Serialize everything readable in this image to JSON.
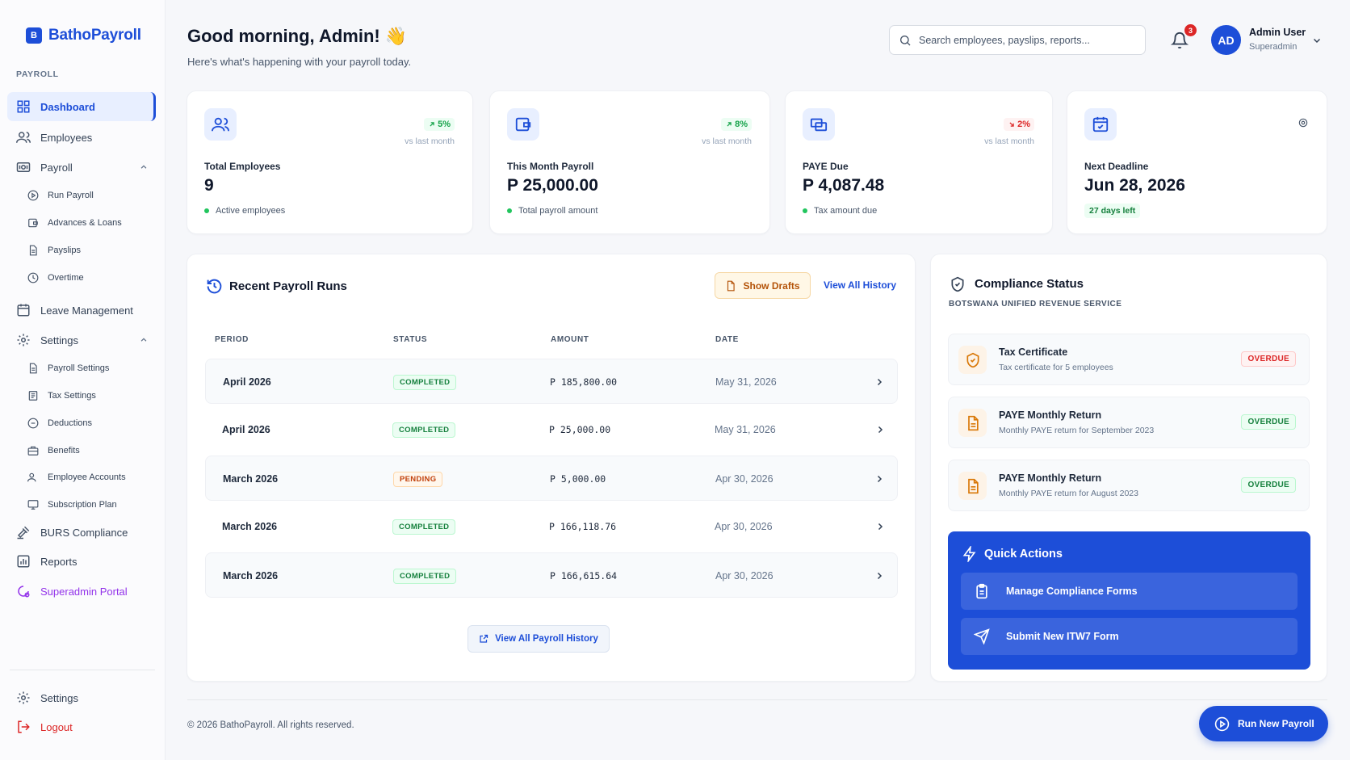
{
  "brand": {
    "logo_text": "B",
    "name": "BathoPayroll"
  },
  "sidebar": {
    "section_label": "PAYROLL",
    "dashboard": "Dashboard",
    "employees": "Employees",
    "payroll": "Payroll",
    "run_payroll": "Run Payroll",
    "advances": "Advances & Loans",
    "payslips": "Payslips",
    "overtime": "Overtime",
    "leave": "Leave Management",
    "settings": "Settings",
    "payroll_settings": "Payroll Settings",
    "tax_settings": "Tax Settings",
    "deductions": "Deductions",
    "benefits": "Benefits",
    "employee_accounts": "Employee Accounts",
    "subscription": "Subscription Plan",
    "burs": "BURS Compliance",
    "reports": "Reports",
    "superadmin": "Superadmin Portal",
    "bottom_settings": "Settings",
    "logout": "Logout"
  },
  "header": {
    "greeting": "Good morning, Admin! 👋",
    "subtitle": "Here's what's happening with your payroll today.",
    "search_placeholder": "Search employees, payslips, reports...",
    "notification_count": "3",
    "avatar_initials": "AD",
    "user_name": "Admin User",
    "user_role": "Superadmin"
  },
  "stats": {
    "employees": {
      "label": "Total Employees",
      "value": "9",
      "trend": "5%",
      "trend_sub": "vs last month",
      "note": "Active employees"
    },
    "payroll": {
      "label": "This Month Payroll",
      "value": "P 25,000.00",
      "trend": "8%",
      "trend_sub": "vs last month",
      "note": "Total payroll amount"
    },
    "paye": {
      "label": "PAYE Due",
      "value": "P 4,087.48",
      "trend": "2%",
      "trend_sub": "vs last month",
      "note": "Tax amount due"
    },
    "deadline": {
      "label": "Next Deadline",
      "value": "Jun 28, 2026",
      "note": "27 days left"
    }
  },
  "runs": {
    "title": "Recent Payroll Runs",
    "show_drafts": "Show Drafts",
    "view_all": "View All History",
    "columns": [
      "PERIOD",
      "STATUS",
      "AMOUNT",
      "DATE"
    ],
    "rows": [
      {
        "period": "April 2026",
        "status": "COMPLETED",
        "amount": "P 185,800.00",
        "date": "May 31, 2026"
      },
      {
        "period": "April 2026",
        "status": "COMPLETED",
        "amount": "P 25,000.00",
        "date": "May 31, 2026"
      },
      {
        "period": "March 2026",
        "status": "PENDING",
        "amount": "P 5,000.00",
        "date": "Apr 30, 2026"
      },
      {
        "period": "March 2026",
        "status": "COMPLETED",
        "amount": "P 166,118.76",
        "date": "Apr 30, 2026"
      },
      {
        "period": "March 2026",
        "status": "COMPLETED",
        "amount": "P 166,615.64",
        "date": "Apr 30, 2026"
      }
    ],
    "view_all_button": "View All Payroll History"
  },
  "compliance": {
    "title": "Compliance Status",
    "subtitle": "BOTSWANA UNIFIED REVENUE SERVICE",
    "items": [
      {
        "name": "Tax Certificate",
        "desc": "Tax certificate for 5 employees",
        "badge": "OVERDUE"
      },
      {
        "name": "PAYE Monthly Return",
        "desc": "Monthly PAYE return for September 2023",
        "badge": "OVERDUE"
      },
      {
        "name": "PAYE Monthly Return",
        "desc": "Monthly PAYE return for August 2023",
        "badge": "OVERDUE"
      }
    ],
    "quick_title": "Quick Actions",
    "quick_manage": "Manage Compliance Forms",
    "quick_submit": "Submit New ITW7 Form"
  },
  "footer": {
    "copyright": "© 2026 BathoPayroll. All rights reserved.",
    "run_button": "Run New Payroll"
  },
  "colors": {
    "primary": "#1d4ed8",
    "success": "#16a34a",
    "danger": "#dc2626",
    "warning": "#d97706",
    "purple": "#9333ea"
  }
}
